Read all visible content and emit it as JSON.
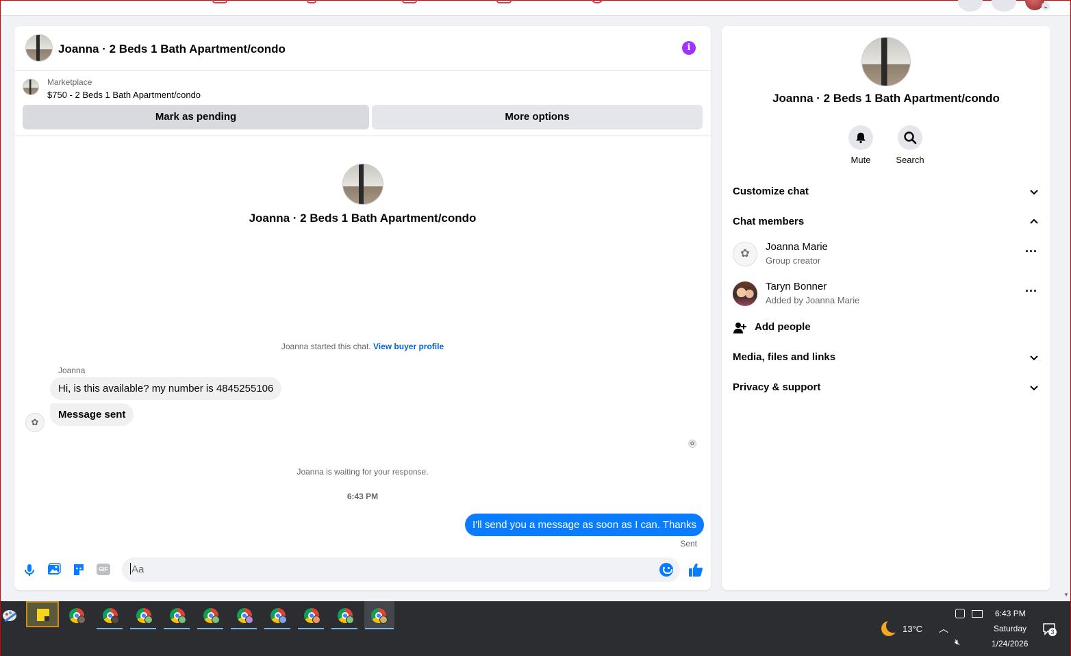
{
  "chat": {
    "title": "Joanna · 2 Beds 1 Bath Apartment/condo",
    "listing_source": "Marketplace",
    "listing_title": "$750 - 2 Beds 1 Bath Apartment/condo",
    "buttons": {
      "pending": "Mark as pending",
      "more": "More options"
    },
    "profile_name": "Joanna · 2 Beds 1 Bath Apartment/condo",
    "started_text": "Joanna started this chat.",
    "started_link": "View buyer profile",
    "sender_name": "Joanna",
    "messages_in": [
      "Hi, is this available? my number is 4845255106",
      "Message sent"
    ],
    "waiting_text": "Joanna is waiting for your response.",
    "time": "6:43 PM",
    "message_out": "I'll send you a message as soon as I can. Thanks",
    "status": "Sent",
    "composer": {
      "placeholder": "Aa",
      "gif_label": "GIF"
    }
  },
  "side": {
    "name": "Joanna · 2 Beds 1 Bath Apartment/condo",
    "actions": {
      "mute": "Mute",
      "search": "Search"
    },
    "sections": {
      "customize": "Customize chat",
      "members": "Chat members",
      "media": "Media, files and links",
      "privacy": "Privacy & support"
    },
    "members": [
      {
        "name": "Joanna Marie",
        "sub": "Group creator"
      },
      {
        "name": "Taryn Bonner",
        "sub": "Added by Joanna Marie"
      }
    ],
    "add_people": "Add people"
  },
  "taskbar": {
    "temperature": "13°C",
    "clock_time": "6:43 PM",
    "clock_day": "Saturday",
    "clock_date": "1/24/2026",
    "notification_count": "3"
  },
  "colors": {
    "accent": "#0a7cff",
    "info": "#a033ff",
    "link": "#0064d1"
  },
  "icons": [
    "info-icon",
    "bell-icon",
    "search-icon",
    "chevron-down-icon",
    "chevron-up-icon",
    "more-icon",
    "add-person-icon",
    "mic-icon",
    "image-icon",
    "sticker-icon",
    "gif-icon",
    "emoji-icon",
    "thumbs-up-icon",
    "chrome-icon",
    "sticky-notes-icon",
    "moon-icon",
    "volume-muted-icon",
    "notification-icon"
  ]
}
